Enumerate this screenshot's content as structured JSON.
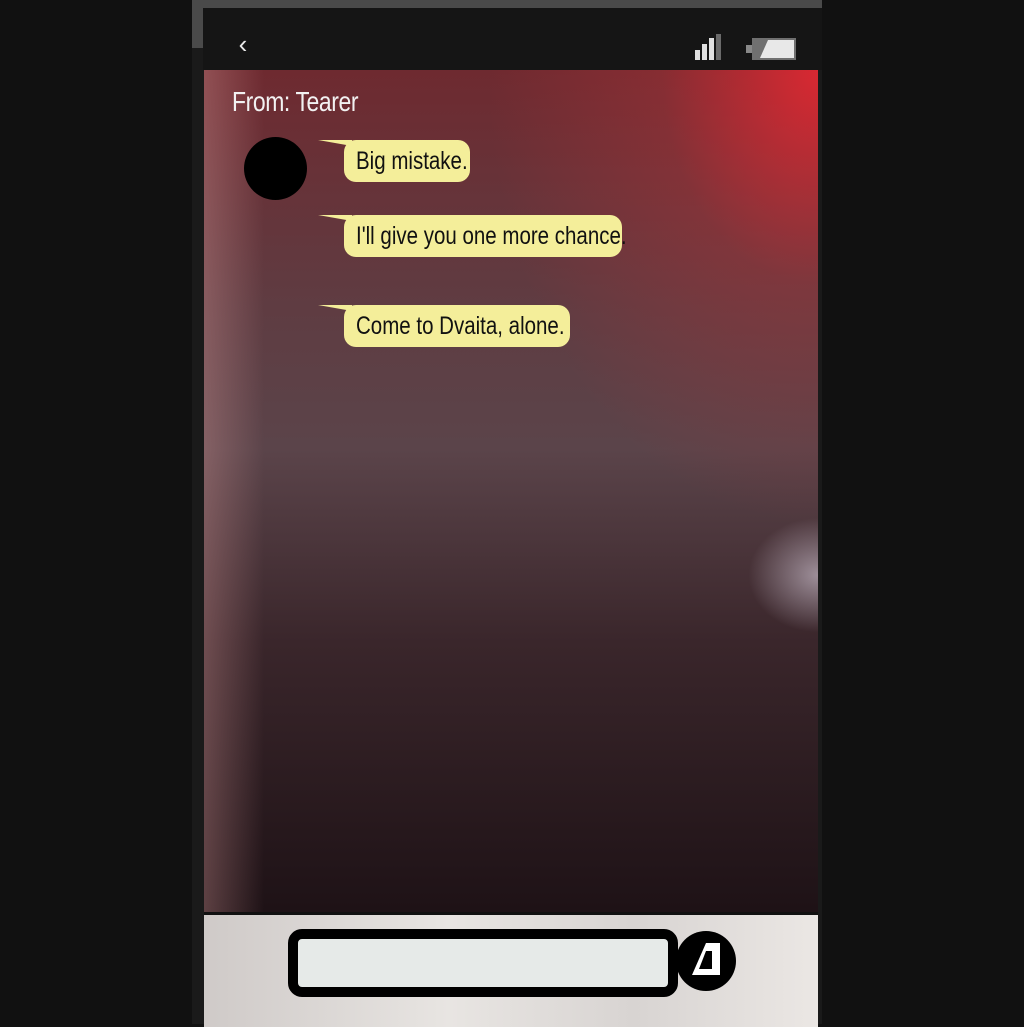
{
  "header": {
    "back_glyph": "‹",
    "back_icon": "chevron-left-icon",
    "signal_icon": "signal-bars-icon",
    "battery_icon": "battery-icon"
  },
  "conversation": {
    "sender_label": "From: Tearer",
    "messages": [
      {
        "text": "Big mistake."
      },
      {
        "text": "I'll give you one more chance."
      },
      {
        "text": "Come to Dvaita, alone."
      }
    ]
  },
  "composer": {
    "input_value": "",
    "send_icon": "send-icon"
  },
  "colors": {
    "bubble": "#f4ee9a",
    "background_accent": "#e8283a",
    "bar": "#151515"
  }
}
